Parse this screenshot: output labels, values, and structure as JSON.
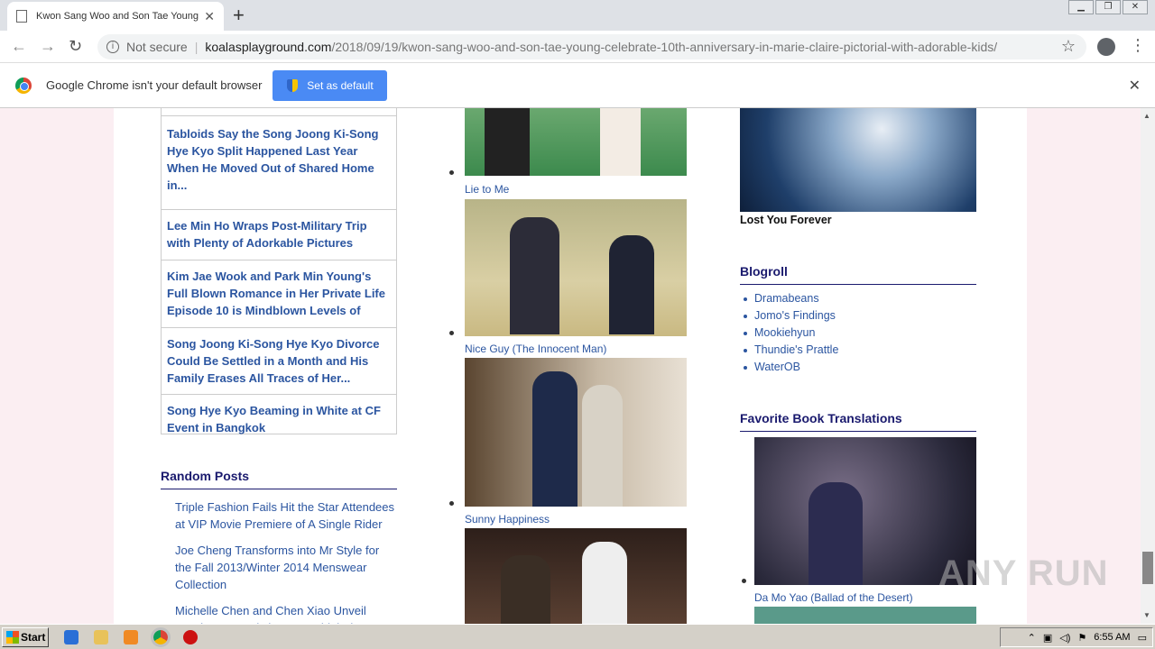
{
  "browser": {
    "tab_title": "Kwon Sang Woo and Son Tae Young",
    "not_secure": "Not secure",
    "url_host": "koalasplayground.com",
    "url_path": "/2018/09/19/kwon-sang-woo-and-son-tae-young-celebrate-10th-anniversary-in-marie-claire-pictorial-with-adorable-kids/"
  },
  "infobar": {
    "message": "Google Chrome isn't your default browser",
    "button": "Set as default"
  },
  "left": {
    "popular": [
      "Tabloids Say the Song Joong Ki-Song Hye Kyo Split Happened Last Year When He Moved Out of Shared Home in...",
      "Lee Min Ho Wraps Post-Military Trip with Plenty of Adorkable Pictures",
      "Kim Jae Wook and Park Min Young's Full Blown Romance in Her Private Life Episode 10 is Mindblown Levels of",
      "Song Joong Ki-Song Hye Kyo Divorce Could Be Settled in a Month and His Family Erases All Traces of Her...",
      "Song Hye Kyo Beaming in White at CF Event in Bangkok"
    ],
    "random_title": "Random Posts",
    "random": [
      "Triple Fashion Fails Hit the Star Attendees at VIP Movie Premiere of A Single Rider",
      "Joe Cheng Transforms into Mr Style for the Fall 2013/Winter 2014 Menswear Collection",
      "Michelle Chen and Chen Xiao Unveil Head Over Heels in Love Bridal Pictures and"
    ]
  },
  "middle": {
    "captions": [
      "Lie to Me",
      "Nice Guy (The Innocent Man)",
      "Sunny Happiness"
    ]
  },
  "right": {
    "book_caption": "Lost You Forever",
    "blogroll_title": "Blogroll",
    "blogroll": [
      "Dramabeans",
      "Jomo's Findings",
      "Mookiehyun",
      "Thundie's Prattle",
      "WaterOB"
    ],
    "fav_title": "Favorite Book Translations",
    "fav_caption": "Da Mo Yao (Ballad of the Desert)"
  },
  "watermark": "ANY RUN",
  "taskbar": {
    "start": "Start",
    "time": "6:55 AM"
  }
}
